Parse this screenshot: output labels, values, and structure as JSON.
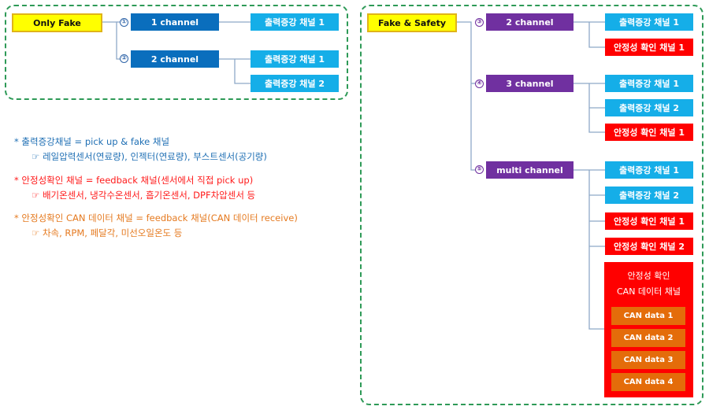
{
  "left_panel": {
    "root_label": "Only Fake",
    "branches": [
      {
        "marker": "①",
        "label": "1 channel",
        "children": [
          "출력증강 채널 1"
        ]
      },
      {
        "marker": "②",
        "label": "2 channel",
        "children": [
          "출력증강 채널 1",
          "출력증강 채널 2"
        ]
      }
    ]
  },
  "right_panel": {
    "root_label": "Fake & Safety",
    "branches": [
      {
        "marker": "③",
        "label": "2 channel",
        "children": [
          "출력증강 채널 1",
          "안정성 확인 채널 1"
        ]
      },
      {
        "marker": "④",
        "label": "3 channel",
        "children": [
          "출력증강 채널 1",
          "출력증강 채널 2",
          "안정성 확인 채널 1"
        ]
      },
      {
        "marker": "⑤",
        "label": "multi channel",
        "children": [
          "출력증강 채널 1",
          "출력증강 채널 2",
          "안정성 확인 채널 1",
          "안정성 확인 채널 2"
        ],
        "can_group": {
          "title_line1": "안정성 확인",
          "title_line2": "CAN 데이터 채널",
          "items": [
            "CAN data 1",
            "CAN data 2",
            "CAN data 3",
            "CAN data 4"
          ]
        }
      }
    ]
  },
  "notes": [
    {
      "title": "* 출력증강채널 = pick up & fake 채널",
      "detail": "☞  레일압력센서(연료량), 인젝터(연료량), 부스트센서(공기량)",
      "color": "#1f6fb4"
    },
    {
      "title": "* 안정성확인 채널 = feedback 채널(센서에서 직접 pick up)",
      "detail": "☞  배기온센서, 냉각수온센서, 흡기온센서, DPF차압센서 등",
      "color": "#ff1a1a"
    },
    {
      "title": "* 안정성확인 CAN 데이터 채널 = feedback 채널(CAN 데이터 receive)",
      "detail": "☞  차속, RPM, 페달각, 미선오일온도 등",
      "color": "#e57a20"
    }
  ],
  "colors": {
    "root_fill": "#ffff00",
    "channel_blue": "#0a6ebd",
    "channel_purple": "#7030a0",
    "output_channel": "#15aee8",
    "safety_channel": "#ff0000",
    "can_item": "#e46c0a",
    "panel_border": "#2e9a57",
    "connector": "#8ea9c8"
  }
}
